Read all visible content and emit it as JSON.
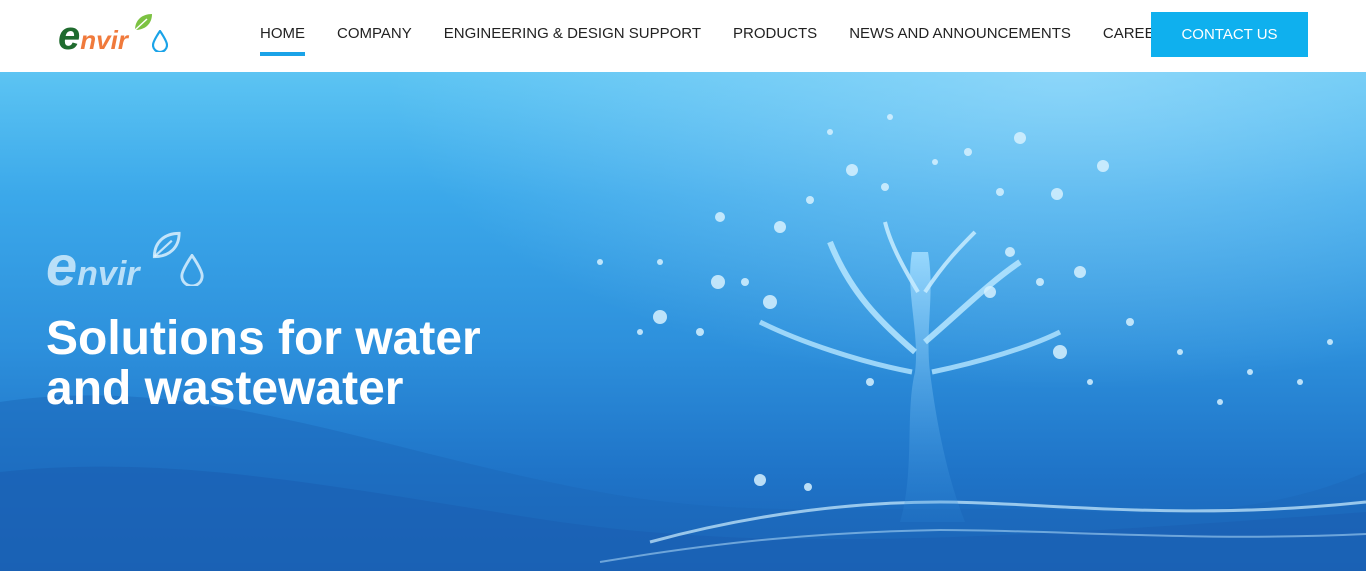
{
  "header": {
    "logo": {
      "letter": "e",
      "rest": "nvir",
      "alt": "Enviro"
    },
    "nav": [
      {
        "label": "HOME",
        "active": true
      },
      {
        "label": "COMPANY",
        "active": false
      },
      {
        "label": "ENGINEERING & DESIGN SUPPORT",
        "active": false
      },
      {
        "label": "PRODUCTS",
        "active": false
      },
      {
        "label": "NEWS AND ANNOUNCEMENTS",
        "active": false
      },
      {
        "label": "CAREER",
        "active": false
      }
    ],
    "contact_label": "CONTACT US"
  },
  "hero": {
    "logo": {
      "letter": "e",
      "rest": "nvir"
    },
    "title_line1": "Solutions for water",
    "title_line2": "and wastewater"
  },
  "colors": {
    "accent": "#0fb0ee",
    "active_underline": "#1aa3e8",
    "logo_green": "#1f6b2e",
    "logo_orange": "#f07a3c",
    "logo_blue": "#1aa3e8"
  },
  "icons": [
    "leaf-icon",
    "water-drop-icon"
  ]
}
